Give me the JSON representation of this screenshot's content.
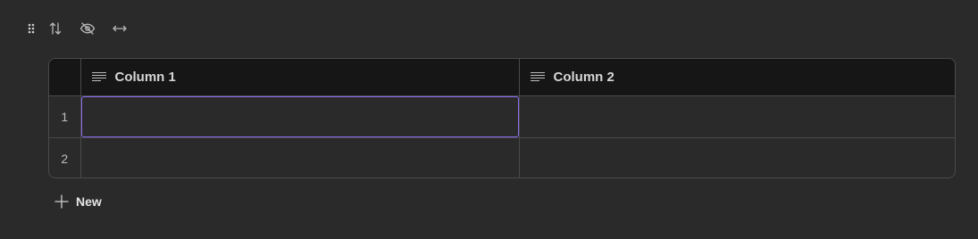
{
  "toolbar": {
    "icons": [
      "drag-handle-icon",
      "sort-icon",
      "eye-off-icon",
      "arrows-horizontal-icon"
    ]
  },
  "table": {
    "columns": [
      {
        "label": "Column 1",
        "icon": "text-lines-icon"
      },
      {
        "label": "Column 2",
        "icon": "text-lines-icon"
      }
    ],
    "rows": [
      {
        "index": "1",
        "cells": [
          "",
          ""
        ]
      },
      {
        "index": "2",
        "cells": [
          "",
          ""
        ]
      }
    ]
  },
  "footer": {
    "new_label": "New",
    "icon": "plus-icon"
  },
  "colors": {
    "background": "#2a2a2a",
    "header_bg": "#161616",
    "border": "#4a4a4a",
    "selection": "#8b6cf0"
  }
}
